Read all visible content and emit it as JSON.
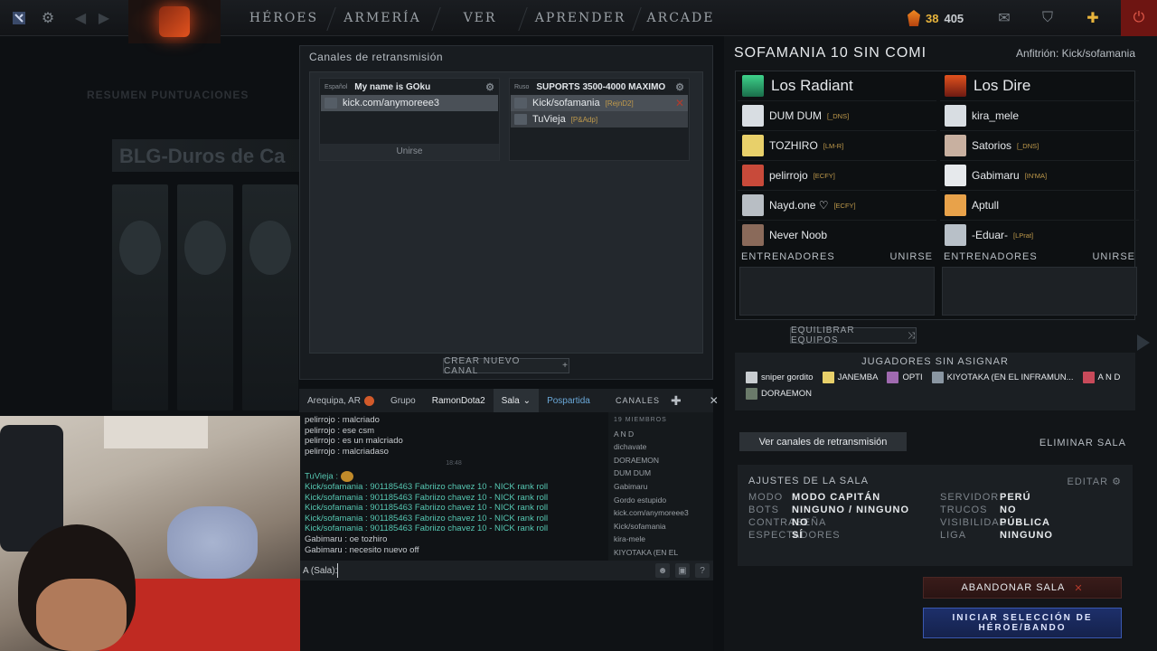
{
  "topbar": {
    "nav": [
      "HÉROES",
      "ARMERÍA",
      "VER",
      "APRENDER",
      "ARCADE"
    ],
    "gold_a": "38",
    "gold_b": "405"
  },
  "background": {
    "tabs": "RESUMEN   PUNTUACIONES",
    "title": "BLG-Duros de Ca"
  },
  "broadcast": {
    "title": "Canales de retransmisión",
    "channels": [
      {
        "lang": "Español",
        "name": "My name is GOku",
        "members": [
          {
            "name": "kick.com/anymoreee3",
            "tag": ""
          }
        ],
        "join": "Unirse"
      },
      {
        "lang": "Ruso",
        "name": "SUPORTS 3500-4000 MAXIMO",
        "members": [
          {
            "name": "Kick/sofamania",
            "tag": "[RejnD2]"
          },
          {
            "name": "TuVieja",
            "tag": "[P&Adp]"
          }
        ]
      }
    ],
    "create": "CREAR NUEVO CANAL"
  },
  "chat": {
    "tabs": [
      "Arequipa, AR",
      "Grupo",
      "RamonDota2",
      "Sala",
      "Pospartida"
    ],
    "channels_label": "CANALES",
    "messages": [
      {
        "name": "pelirrojo",
        "text": " : malcriado"
      },
      {
        "name": "pelirrojo",
        "text": " : ese csm"
      },
      {
        "name": "pelirrojo",
        "text": " : es un malcriado"
      },
      {
        "name": "pelirrojo",
        "text": " : malcriadaso"
      }
    ],
    "time": "18:48",
    "messages2": [
      {
        "name": "TuVieja",
        "text": " : ",
        "teal": true
      },
      {
        "name": "Kick/sofamania",
        "text": " : 901185463 Fabriizo chavez 10 - NICK rank roll",
        "teal": true
      },
      {
        "name": "Kick/sofamania",
        "text": " : 901185463 Fabriizo chavez 10 - NICK rank roll",
        "teal": true
      },
      {
        "name": "Kick/sofamania",
        "text": " : 901185463 Fabriizo chavez 10 - NICK rank roll",
        "teal": true
      },
      {
        "name": "Kick/sofamania",
        "text": " : 901185463 Fabriizo chavez 10 - NICK rank roll",
        "teal": true
      },
      {
        "name": "Kick/sofamania",
        "text": " : 901185463 Fabriizo chavez 10 - NICK rank roll",
        "teal": true
      },
      {
        "name": "Gabimaru",
        "text": " : oe tozhiro"
      },
      {
        "name": "Gabimaru",
        "text": " : necesito nuevo off"
      }
    ],
    "member_count": "19 MIEMBROS",
    "members": [
      "A N D",
      "dichavate",
      "DORAEMON",
      "DUM DUM",
      "Gabimaru",
      "Gordo estupido",
      "kick.com/anymoreee3",
      "Kick/sofamania",
      "kira-mele",
      "KIYOTAKA (EN EL INFRAM"
    ],
    "input_label": "A (Sala): "
  },
  "lobby": {
    "name": "SOFAMANIA 10 SIN COMI",
    "host": "Anfitrión: Kick/sofamania",
    "radiant": {
      "name": "Los Radiant",
      "players": [
        {
          "name": "DUM DUM",
          "tag": "[_DNS]"
        },
        {
          "name": "TOZHIRO",
          "tag": "[LM-R]"
        },
        {
          "name": "pelirrojo",
          "tag": "[ECFY]"
        },
        {
          "name": "Nayd.one ♡",
          "tag": "[ECFY]"
        },
        {
          "name": "Never Noob",
          "tag": ""
        }
      ]
    },
    "dire": {
      "name": "Los Dire",
      "players": [
        {
          "name": "kira_mele",
          "tag": ""
        },
        {
          "name": "Satorios",
          "tag": "[_DNS]"
        },
        {
          "name": "Gabimaru",
          "tag": "[IN'MA]"
        },
        {
          "name": "Aptull",
          "tag": ""
        },
        {
          "name": "-Eduar-",
          "tag": "[LPrat]"
        }
      ]
    },
    "coaches": "ENTRENADORES",
    "join": "UNIRSE",
    "balance": "EQUILIBRAR EQUIPOS",
    "unassigned_title": "JUGADORES SIN ASIGNAR",
    "unassigned": [
      "sniper gordito",
      "JANEMBA",
      "OPTI",
      "KIYOTAKA (EN EL INFRAMUN...",
      "A N D",
      "DORAEMON"
    ],
    "view_broadcast": "Ver canales de retransmisión",
    "delete": "ELIMINAR SALA",
    "settings": {
      "title": "AJUSTES DE LA SALA",
      "edit": "EDITAR",
      "rows": [
        {
          "k": "MODO",
          "v": "MODO CAPITÁN",
          "k2": "SERVIDOR",
          "v2": "PERÚ"
        },
        {
          "k": "BOTS",
          "v": "NINGUNO / NINGUNO",
          "k2": "TRUCOS",
          "v2": "NO"
        },
        {
          "k": "CONTRASEÑA",
          "v": "NO",
          "k2": "VISIBILIDAD",
          "v2": "PÚBLICA"
        },
        {
          "k": "ESPECTADORES",
          "v": "SÍ",
          "k2": "LIGA",
          "v2": "NINGUNO"
        }
      ]
    },
    "leave": "ABANDONAR SALA",
    "start": "INICIAR SELECCIÓN DE HÉROE/BANDO"
  }
}
